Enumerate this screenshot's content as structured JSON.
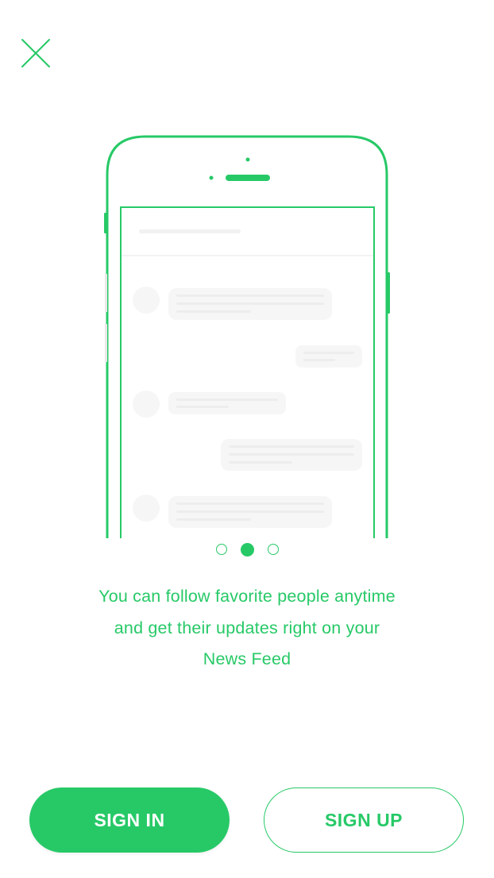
{
  "colors": {
    "accent": "#27c967",
    "background": "#ffffff",
    "placeholder": "#f6f6f6"
  },
  "close": {
    "icon": "close-icon"
  },
  "illustration": {
    "icon": "phone-news-feed-illustration"
  },
  "pager": {
    "count": 3,
    "active_index": 1
  },
  "description": {
    "lines": [
      "You can follow favorite people anytime",
      "and get their updates right on your",
      "News Feed"
    ]
  },
  "buttons": {
    "sign_in": "SIGN IN",
    "sign_up": "SIGN UP"
  }
}
